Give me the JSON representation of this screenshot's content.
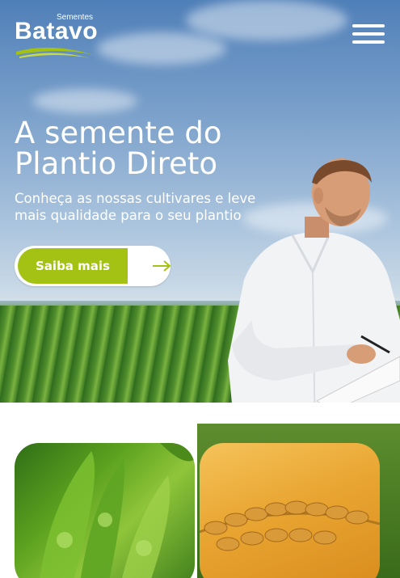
{
  "brand": {
    "small_text": "Sementes",
    "name": "Batavo",
    "swoosh_color": "#a3c214"
  },
  "header": {
    "menu_icon": "hamburger-menu-icon"
  },
  "hero": {
    "headline_line1": "A semente do",
    "headline_line2": "Plantio Direto",
    "subtitle_line1": "Conheça as nossas cultivares e leve",
    "subtitle_line2": "mais qualidade para o seu plantio",
    "cta_label": "Saiba mais",
    "cta_icon": "arrow-right-icon",
    "accent_color": "#a3c214"
  },
  "cards": [
    {
      "image": "soybean-pods"
    },
    {
      "image": "wheat-ears"
    }
  ]
}
